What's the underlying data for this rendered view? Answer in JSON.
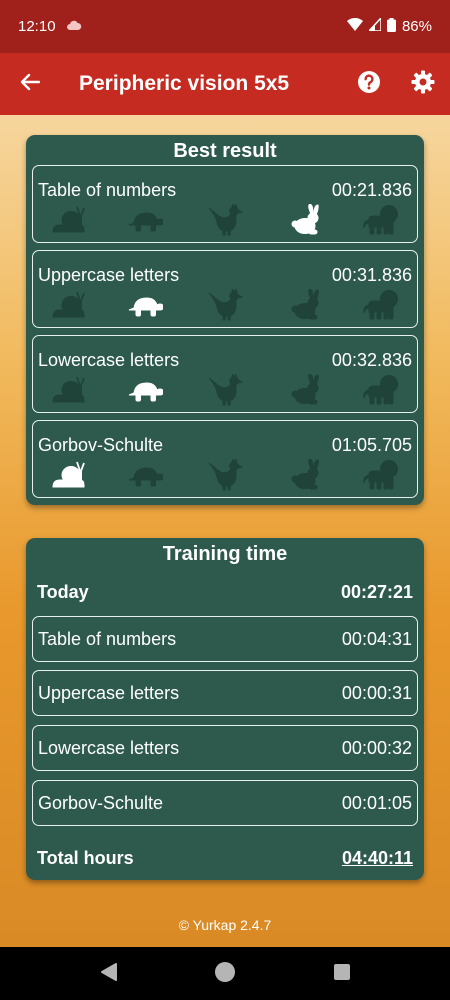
{
  "status": {
    "time": "12:10",
    "battery": "86%"
  },
  "app_bar": {
    "title": "Peripheric vision 5x5",
    "icons": [
      "back-arrow-icon",
      "help-icon",
      "gear-icon"
    ]
  },
  "best_result": {
    "title": "Best result",
    "animal_order": [
      "snail",
      "turtle",
      "rooster",
      "rabbit",
      "lion"
    ],
    "items": [
      {
        "label": "Table of numbers",
        "value": "00:21.836",
        "highlight": "rabbit"
      },
      {
        "label": "Uppercase letters",
        "value": "00:31.836",
        "highlight": "turtle"
      },
      {
        "label": "Lowercase letters",
        "value": "00:32.836",
        "highlight": "turtle"
      },
      {
        "label": "Gorbov-Schulte",
        "value": "01:05.705",
        "highlight": "snail"
      }
    ]
  },
  "training_time": {
    "title": "Training time",
    "today_label": "Today",
    "today_value": "00:27:21",
    "items": [
      {
        "label": "Table of numbers",
        "value": "00:04:31"
      },
      {
        "label": "Uppercase letters",
        "value": "00:00:31"
      },
      {
        "label": "Lowercase letters",
        "value": "00:00:32"
      },
      {
        "label": "Gorbov-Schulte",
        "value": "00:01:05"
      }
    ],
    "total_label": "Total hours",
    "total_value": "04:40:11"
  },
  "footer": {
    "text": "© Yurkap 2.4.7"
  },
  "colors": {
    "app_bar": "#c62b22",
    "status_bar": "#a0211c",
    "card": "#2e5a4e",
    "animal_dim": "#1f4239",
    "animal_active": "#ffffff"
  }
}
